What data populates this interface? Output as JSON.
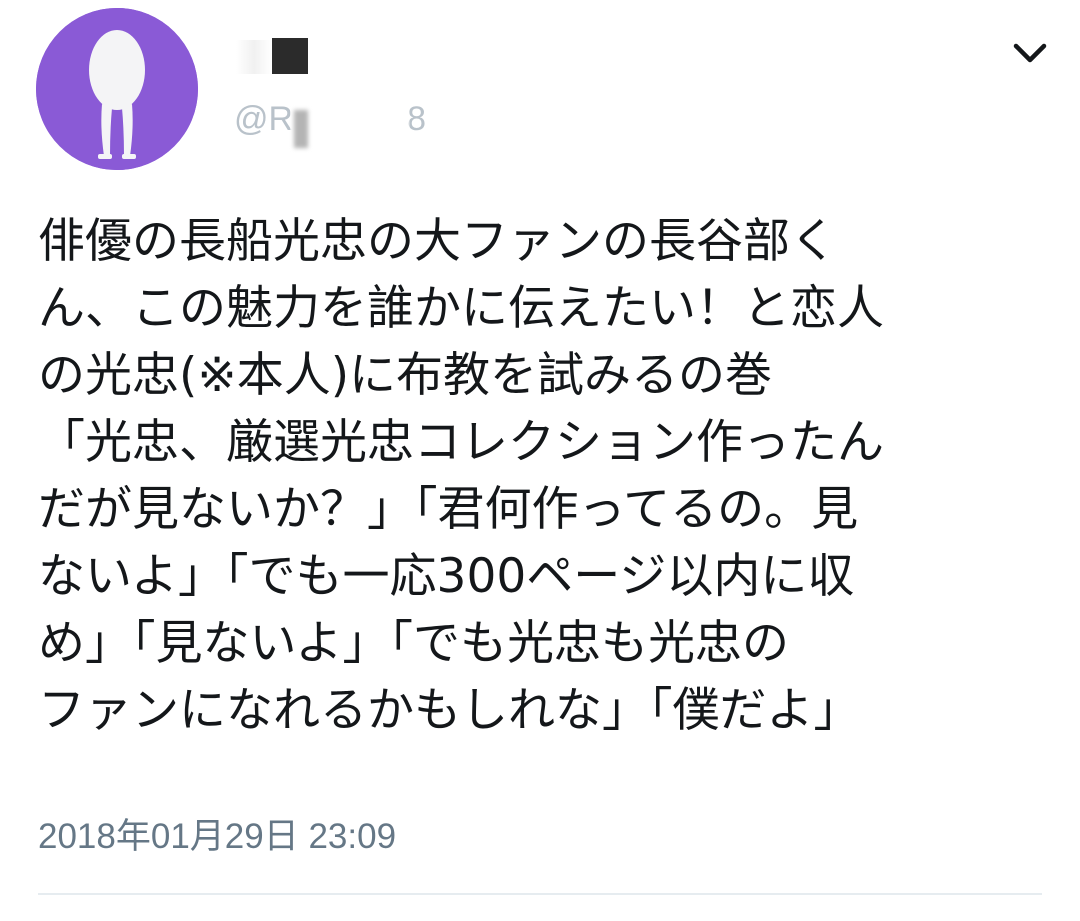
{
  "tweet": {
    "author": {
      "handle": "@R",
      "handle_tail": "8",
      "avatar_icon": "egg-legs-avatar-icon",
      "avatar_color": "#8a5ad6"
    },
    "menu_icon": "chevron-down-icon",
    "text_lines": [
      "俳優の長船光忠の大ファンの長谷部く",
      "ん、この魅力を誰かに伝えたい！と恋人",
      "の光忠(※本人)に布教を試みるの巻",
      "「光忠、厳選光忠コレクション作ったん",
      "だが見ないか？」「君何作ってるの。見",
      "ないよ」「でも一応300ページ以内に収",
      "め」「見ないよ」「でも光忠も光忠の",
      "ファンになれるかもしれな」「僕だよ」"
    ],
    "timestamp": "2018年01月29日 23:09"
  }
}
